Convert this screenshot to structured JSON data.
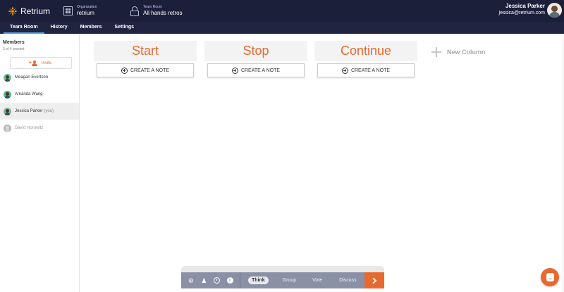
{
  "app": {
    "name": "Retrium"
  },
  "org": {
    "label": "Organization",
    "value": "retrium"
  },
  "room": {
    "label": "Team Room",
    "value": "All hands retros"
  },
  "user": {
    "name": "Jessica Parker",
    "email": "jessica@retrium.com"
  },
  "nav": {
    "tabs": [
      "Team Room",
      "History",
      "Members",
      "Settings"
    ],
    "active": "Team Room"
  },
  "sidebar": {
    "title": "Members",
    "count": "3 of 4 present",
    "invite_label": "Invite",
    "members": [
      {
        "name": "Meagan Evertson",
        "you": ""
      },
      {
        "name": "Amanda Wang",
        "you": ""
      },
      {
        "name": "Jessica Parker",
        "you": "(you)"
      },
      {
        "name": "David Horowitz",
        "you": ""
      }
    ]
  },
  "board": {
    "columns": [
      "Start",
      "Stop",
      "Continue"
    ],
    "note_label": "CREATE A NOTE",
    "new_column_label": "New Column"
  },
  "toolbar": {
    "phases": [
      "Think",
      "Group",
      "Vote",
      "Discuss"
    ],
    "active_phase": "Think",
    "icons": [
      "gear-icon",
      "bell-icon",
      "timer-icon",
      "info-icon"
    ],
    "info_glyph": "i"
  },
  "colors": {
    "accent": "#e8692f",
    "header": "#1b1f3a",
    "nav": "#202441",
    "toolbar": "#8a90a6"
  }
}
